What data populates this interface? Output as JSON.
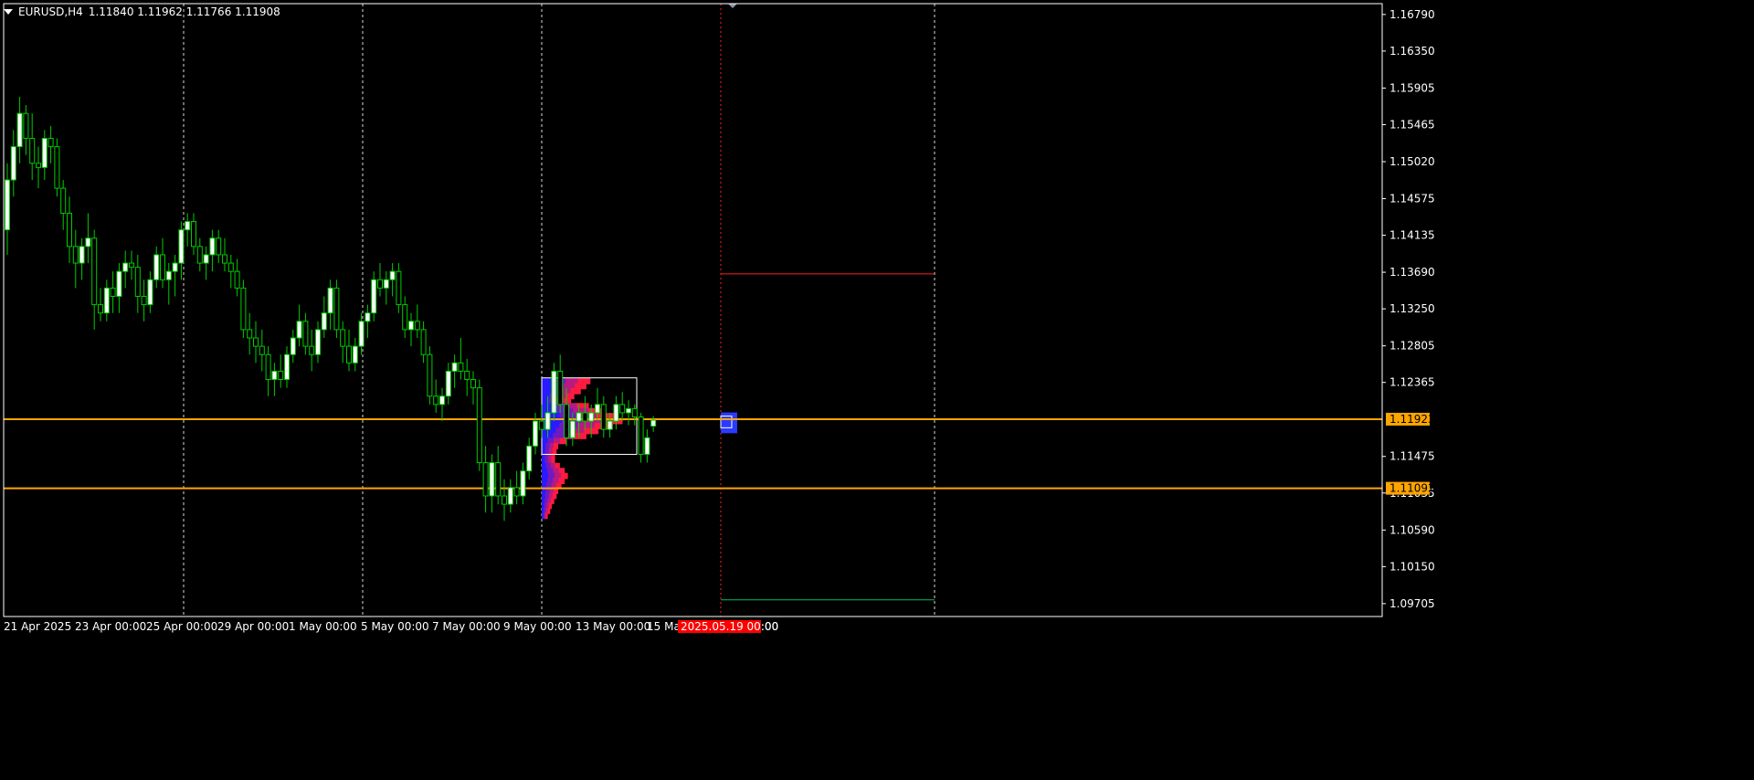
{
  "header": {
    "symbol": "EURUSD,H4",
    "ohlc": "1.11840 1.11962 1.11766 1.11908"
  },
  "colors": {
    "background": "#000000",
    "bull_candle": "#ffffff",
    "bear_candle": "#000000",
    "wick": "#00cc00",
    "grid": "#ffffff",
    "level_line": "#ffa500",
    "level_label_bg": "#ffa500",
    "red_line": "#ff2020",
    "green_line": "#00c060",
    "profile_low": "#2a1aff",
    "profile_high": "#ff1a40",
    "cursor_date_bg": "#ff0000"
  },
  "chart_data": {
    "type": "candlestick",
    "title": "EURUSD,H4",
    "ylim": [
      1.0955,
      1.1692
    ],
    "y_ticks": [
      "1.16790",
      "1.16350",
      "1.15905",
      "1.15465",
      "1.15020",
      "1.14575",
      "1.14135",
      "1.13690",
      "1.13250",
      "1.12805",
      "1.12365",
      "1.11475",
      "1.11035",
      "1.10590",
      "1.10150",
      "1.09705"
    ],
    "x_ticks": [
      "21 Apr 2025",
      "23 Apr 00:00",
      "25 Apr 00:00",
      "29 Apr 00:00",
      "1 May 00:00",
      "5 May 00:00",
      "7 May 00:00",
      "9 May 00:00",
      "13 May 00:00",
      "15 May",
      ":00"
    ],
    "day_separators": [
      "25 Apr 00:00",
      "5 May 00:00",
      "9 May 00:00",
      "15 May"
    ],
    "cursor_date_label": "2025.05.19 00:00",
    "horizontal_levels": [
      {
        "price": 1.11923,
        "label": "1.11923"
      },
      {
        "price": 1.11092,
        "label": "1.11092"
      }
    ],
    "projection_lines": [
      {
        "price": 1.1367,
        "color": "red"
      },
      {
        "price": 1.0975,
        "color": "green"
      }
    ],
    "candles": [
      [
        1.142,
        1.15,
        1.139,
        1.148
      ],
      [
        1.148,
        1.154,
        1.146,
        1.152
      ],
      [
        1.152,
        1.158,
        1.15,
        1.156
      ],
      [
        1.156,
        1.157,
        1.151,
        1.153
      ],
      [
        1.153,
        1.156,
        1.148,
        1.15
      ],
      [
        1.15,
        1.152,
        1.147,
        1.1495
      ],
      [
        1.1495,
        1.154,
        1.148,
        1.153
      ],
      [
        1.153,
        1.1545,
        1.15,
        1.152
      ],
      [
        1.152,
        1.153,
        1.146,
        1.147
      ],
      [
        1.147,
        1.148,
        1.142,
        1.144
      ],
      [
        1.144,
        1.146,
        1.138,
        1.14
      ],
      [
        1.14,
        1.142,
        1.135,
        1.138
      ],
      [
        1.138,
        1.141,
        1.136,
        1.14
      ],
      [
        1.14,
        1.144,
        1.138,
        1.141
      ],
      [
        1.141,
        1.142,
        1.13,
        1.133
      ],
      [
        1.133,
        1.135,
        1.131,
        1.132
      ],
      [
        1.132,
        1.136,
        1.131,
        1.135
      ],
      [
        1.135,
        1.137,
        1.132,
        1.134
      ],
      [
        1.134,
        1.138,
        1.132,
        1.137
      ],
      [
        1.137,
        1.1395,
        1.135,
        1.138
      ],
      [
        1.138,
        1.1395,
        1.136,
        1.1375
      ],
      [
        1.1375,
        1.139,
        1.132,
        1.134
      ],
      [
        1.134,
        1.136,
        1.131,
        1.133
      ],
      [
        1.133,
        1.137,
        1.132,
        1.136
      ],
      [
        1.136,
        1.14,
        1.135,
        1.139
      ],
      [
        1.139,
        1.141,
        1.135,
        1.136
      ],
      [
        1.136,
        1.138,
        1.133,
        1.137
      ],
      [
        1.137,
        1.139,
        1.134,
        1.138
      ],
      [
        1.138,
        1.143,
        1.136,
        1.142
      ],
      [
        1.142,
        1.144,
        1.14,
        1.143
      ],
      [
        1.143,
        1.144,
        1.139,
        1.14
      ],
      [
        1.14,
        1.141,
        1.137,
        1.138
      ],
      [
        1.138,
        1.14,
        1.136,
        1.139
      ],
      [
        1.139,
        1.142,
        1.137,
        1.141
      ],
      [
        1.141,
        1.142,
        1.138,
        1.139
      ],
      [
        1.139,
        1.141,
        1.137,
        1.138
      ],
      [
        1.138,
        1.139,
        1.135,
        1.137
      ],
      [
        1.137,
        1.1385,
        1.134,
        1.135
      ],
      [
        1.135,
        1.136,
        1.129,
        1.13
      ],
      [
        1.13,
        1.132,
        1.127,
        1.129
      ],
      [
        1.129,
        1.131,
        1.126,
        1.128
      ],
      [
        1.128,
        1.13,
        1.125,
        1.127
      ],
      [
        1.127,
        1.128,
        1.122,
        1.124
      ],
      [
        1.124,
        1.126,
        1.122,
        1.125
      ],
      [
        1.125,
        1.127,
        1.123,
        1.124
      ],
      [
        1.124,
        1.128,
        1.123,
        1.127
      ],
      [
        1.127,
        1.13,
        1.126,
        1.129
      ],
      [
        1.129,
        1.133,
        1.128,
        1.131
      ],
      [
        1.131,
        1.132,
        1.127,
        1.128
      ],
      [
        1.128,
        1.13,
        1.125,
        1.127
      ],
      [
        1.127,
        1.131,
        1.126,
        1.13
      ],
      [
        1.13,
        1.134,
        1.129,
        1.132
      ],
      [
        1.132,
        1.136,
        1.13,
        1.135
      ],
      [
        1.135,
        1.136,
        1.129,
        1.13
      ],
      [
        1.13,
        1.131,
        1.126,
        1.128
      ],
      [
        1.128,
        1.13,
        1.125,
        1.126
      ],
      [
        1.126,
        1.129,
        1.125,
        1.128
      ],
      [
        1.128,
        1.132,
        1.127,
        1.131
      ],
      [
        1.131,
        1.133,
        1.129,
        1.132
      ],
      [
        1.132,
        1.137,
        1.131,
        1.136
      ],
      [
        1.136,
        1.138,
        1.134,
        1.135
      ],
      [
        1.135,
        1.137,
        1.133,
        1.136
      ],
      [
        1.136,
        1.138,
        1.134,
        1.137
      ],
      [
        1.137,
        1.138,
        1.132,
        1.133
      ],
      [
        1.133,
        1.134,
        1.129,
        1.13
      ],
      [
        1.13,
        1.132,
        1.128,
        1.131
      ],
      [
        1.131,
        1.133,
        1.129,
        1.13
      ],
      [
        1.13,
        1.131,
        1.126,
        1.127
      ],
      [
        1.127,
        1.128,
        1.121,
        1.122
      ],
      [
        1.122,
        1.124,
        1.12,
        1.121
      ],
      [
        1.121,
        1.123,
        1.119,
        1.122
      ],
      [
        1.122,
        1.126,
        1.121,
        1.125
      ],
      [
        1.125,
        1.127,
        1.123,
        1.126
      ],
      [
        1.126,
        1.129,
        1.124,
        1.125
      ],
      [
        1.125,
        1.1265,
        1.122,
        1.124
      ],
      [
        1.124,
        1.125,
        1.121,
        1.123
      ],
      [
        1.123,
        1.124,
        1.113,
        1.114
      ],
      [
        1.114,
        1.116,
        1.108,
        1.11
      ],
      [
        1.11,
        1.115,
        1.108,
        1.114
      ],
      [
        1.114,
        1.116,
        1.109,
        1.11
      ],
      [
        1.11,
        1.112,
        1.107,
        1.109
      ],
      [
        1.109,
        1.112,
        1.108,
        1.111
      ],
      [
        1.111,
        1.113,
        1.109,
        1.11
      ],
      [
        1.11,
        1.114,
        1.109,
        1.113
      ],
      [
        1.113,
        1.117,
        1.112,
        1.116
      ],
      [
        1.116,
        1.12,
        1.115,
        1.119
      ],
      [
        1.119,
        1.121,
        1.117,
        1.118
      ],
      [
        1.118,
        1.122,
        1.117,
        1.12
      ],
      [
        1.12,
        1.126,
        1.119,
        1.125
      ],
      [
        1.125,
        1.127,
        1.12,
        1.121
      ],
      [
        1.121,
        1.123,
        1.116,
        1.117
      ],
      [
        1.117,
        1.12,
        1.116,
        1.119
      ],
      [
        1.119,
        1.121,
        1.117,
        1.12
      ],
      [
        1.12,
        1.122,
        1.118,
        1.119
      ],
      [
        1.119,
        1.121,
        1.117,
        1.12
      ],
      [
        1.12,
        1.123,
        1.119,
        1.121
      ],
      [
        1.121,
        1.122,
        1.117,
        1.118
      ],
      [
        1.118,
        1.12,
        1.117,
        1.119
      ],
      [
        1.119,
        1.122,
        1.118,
        1.121
      ],
      [
        1.121,
        1.1225,
        1.119,
        1.12
      ],
      [
        1.12,
        1.1215,
        1.1185,
        1.1205
      ],
      [
        1.1205,
        1.121,
        1.1185,
        1.1195
      ],
      [
        1.1195,
        1.12,
        1.114,
        1.115
      ],
      [
        1.115,
        1.118,
        1.114,
        1.117
      ],
      [
        1.1184,
        1.1196,
        1.1177,
        1.1191
      ]
    ],
    "volume_profile": [
      {
        "price": 1.1238,
        "volume": 60
      },
      {
        "price": 1.1232,
        "volume": 55
      },
      {
        "price": 1.1226,
        "volume": 48
      },
      {
        "price": 1.122,
        "volume": 40
      },
      {
        "price": 1.1214,
        "volume": 36
      },
      {
        "price": 1.1208,
        "volume": 58
      },
      {
        "price": 1.1202,
        "volume": 78
      },
      {
        "price": 1.1196,
        "volume": 90
      },
      {
        "price": 1.119,
        "volume": 100
      },
      {
        "price": 1.1184,
        "volume": 88
      },
      {
        "price": 1.1178,
        "volume": 70
      },
      {
        "price": 1.1172,
        "volume": 55
      },
      {
        "price": 1.1166,
        "volume": 30
      },
      {
        "price": 1.116,
        "volume": 20
      },
      {
        "price": 1.1154,
        "volume": 18
      },
      {
        "price": 1.1148,
        "volume": 16
      },
      {
        "price": 1.1142,
        "volume": 16
      },
      {
        "price": 1.1136,
        "volume": 22
      },
      {
        "price": 1.113,
        "volume": 28
      },
      {
        "price": 1.1124,
        "volume": 32
      },
      {
        "price": 1.1118,
        "volume": 28
      },
      {
        "price": 1.1112,
        "volume": 24
      },
      {
        "price": 1.1106,
        "volume": 20
      },
      {
        "price": 1.11,
        "volume": 18
      },
      {
        "price": 1.1094,
        "volume": 15
      },
      {
        "price": 1.1088,
        "volume": 12
      },
      {
        "price": 1.1082,
        "volume": 10
      },
      {
        "price": 1.1076,
        "volume": 7
      }
    ],
    "value_area_box": {
      "price_high": 1.1242,
      "price_low": 1.115
    },
    "current_profile": {
      "price_high": 1.1196,
      "price_low": 1.1182
    }
  }
}
